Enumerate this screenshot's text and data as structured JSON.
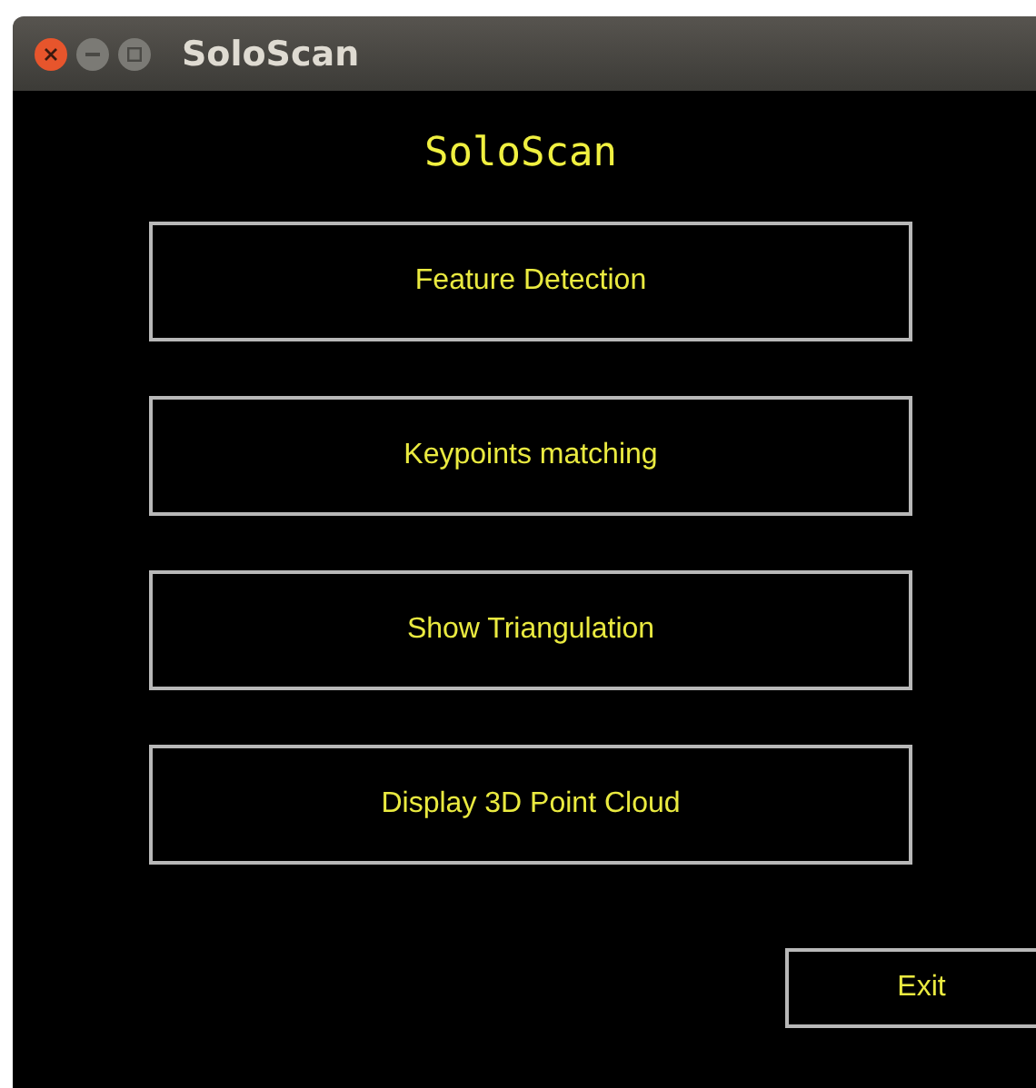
{
  "window": {
    "title": "SoloScan"
  },
  "heading": "SoloScan",
  "buttons": [
    {
      "label": "Feature Detection"
    },
    {
      "label": "Keypoints matching"
    },
    {
      "label": "Show Triangulation"
    },
    {
      "label": "Display 3D Point Cloud"
    }
  ],
  "exit_button": {
    "label": "Exit"
  }
}
